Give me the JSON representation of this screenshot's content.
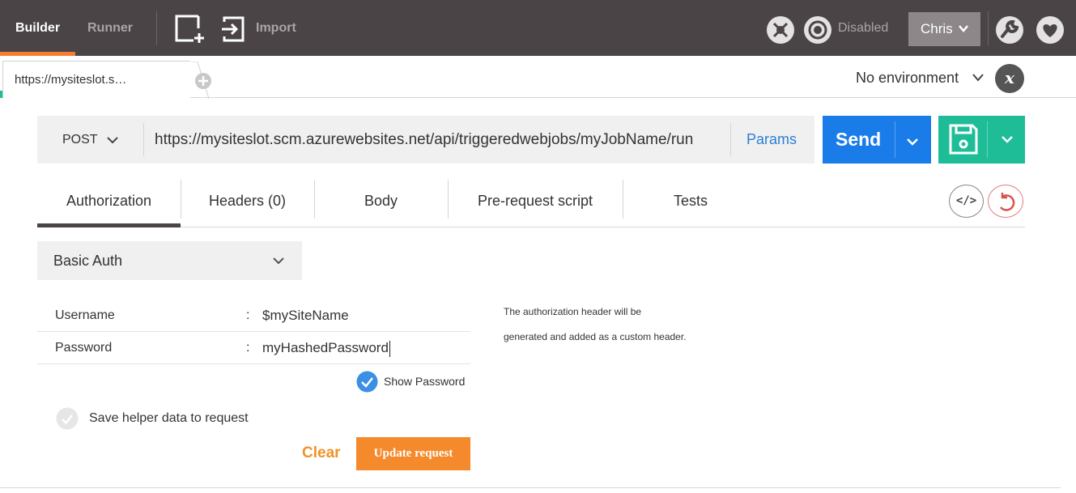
{
  "topbar": {
    "builder_label": "Builder",
    "runner_label": "Runner",
    "import_label": "Import",
    "sync_status": "Disabled",
    "user_name": "Chris",
    "icons": [
      "new-window-icon",
      "import-icon",
      "interceptor-icon",
      "sync-icon",
      "settings-icon",
      "heart-icon"
    ]
  },
  "tabs": {
    "request_tab_label": "https://mysiteslot.s…",
    "environment_label": "No environment"
  },
  "request": {
    "method": "POST",
    "url": "https://mysiteslot.scm.azurewebsites.net/api/triggeredwebjobs/myJobName/run",
    "params_label": "Params",
    "send_label": "Send"
  },
  "subtabs": {
    "authorization": "Authorization",
    "headers": "Headers (0)",
    "body": "Body",
    "prerequest": "Pre-request script",
    "tests": "Tests",
    "active": "Authorization"
  },
  "auth": {
    "type": "Basic Auth",
    "username_label": "Username",
    "username_value": "$mySiteName",
    "password_label": "Password",
    "password_value": "myHashedPassword",
    "colon": ":",
    "show_password_label": "Show Password",
    "show_password_checked": true,
    "help_line1": "The authorization header will be",
    "help_line2": "generated and added as a custom header.",
    "save_helper_label": "Save helper data to request",
    "save_helper_checked": false,
    "clear_label": "Clear",
    "update_label": "Update request"
  },
  "colors": {
    "topbar": "#4a4446",
    "accent_orange": "#f47d31",
    "send_blue": "#1a7ce8",
    "save_green": "#1fbd97",
    "link_blue": "#2a7fd5",
    "clear_orange": "#f09228"
  }
}
